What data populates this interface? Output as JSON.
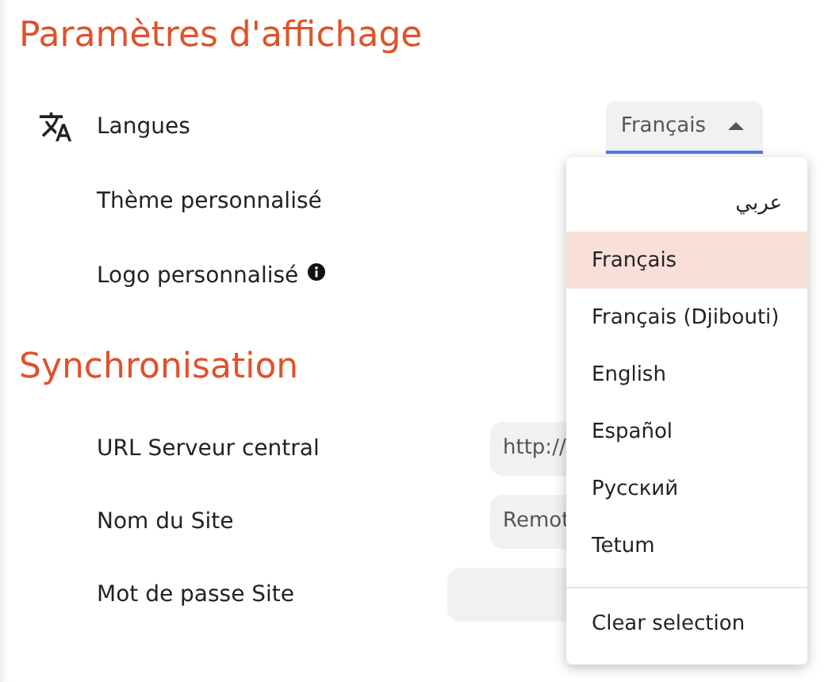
{
  "sections": [
    {
      "title": "Paramètres d'affichage",
      "rows": [
        {
          "kind": "select",
          "label": "Langues",
          "icon": true,
          "value": "Français",
          "open": true
        },
        {
          "kind": "plain",
          "label": "Thème personnalisé"
        },
        {
          "kind": "plain",
          "label": "Logo personnalisé",
          "info": true
        }
      ]
    },
    {
      "title": "Synchronisation",
      "rows": [
        {
          "kind": "input",
          "label": "URL Serveur central",
          "value": "http://"
        },
        {
          "kind": "input",
          "label": "Nom du Site",
          "value": "Remot"
        },
        {
          "kind": "input",
          "label": "Mot de passe Site",
          "wide": true
        }
      ]
    }
  ],
  "menu": {
    "items": [
      {
        "label": "عربي",
        "rtl": true,
        "selected": false
      },
      {
        "label": "Français",
        "selected": true
      },
      {
        "label": "Français (Djibouti)",
        "selected": false
      },
      {
        "label": "English",
        "selected": false
      },
      {
        "label": "Español",
        "selected": false
      },
      {
        "label": "Русский",
        "selected": false
      },
      {
        "label": "Tetum",
        "selected": false
      }
    ],
    "clear": "Clear selection"
  }
}
